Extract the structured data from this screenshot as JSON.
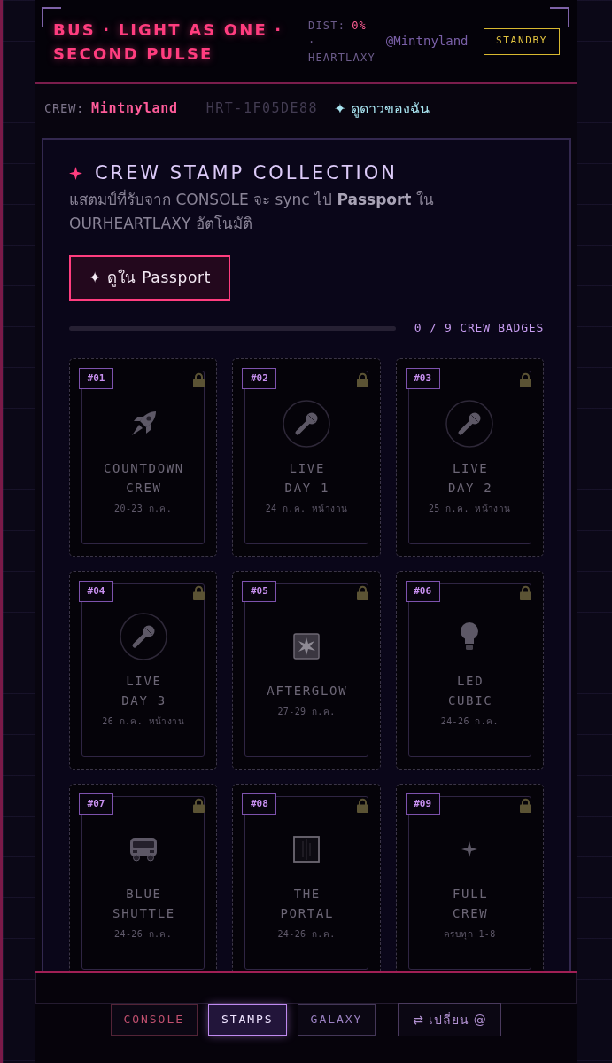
{
  "header": {
    "title": "BUS · LIGHT AS ONE · SECOND PULSE",
    "distance_label": "DIST:",
    "distance_value": "0%",
    "separator": "·",
    "network": "HEARTLAXY",
    "handle": "@Mintnyland",
    "status": "STANDBY"
  },
  "crew_bar": {
    "label": "CREW:",
    "name": "Mintnyland",
    "code": "HRT-1F05DE88",
    "link": "✦ ดูดาวของฉัน"
  },
  "collection": {
    "title": "CREW STAMP COLLECTION",
    "description": "แสตมป์ที่รับจาก CONSOLE จะ sync ไป **Passport** ใน OURHEARTLAXY อัตโนมัติ",
    "button": "✦ ดูใน Passport",
    "progress": {
      "level": 0,
      "label": "0 / 9 CREW BADGES"
    },
    "stamps": [
      {
        "number": "#01",
        "kind": "countdown",
        "title": "COUNTDOWN\nCREW",
        "date": "20-23 ก.ค.",
        "locked": true
      },
      {
        "number": "#02",
        "kind": "live",
        "title": "LIVE\nDAY 1",
        "date": "24 ก.ค. หน้างาน",
        "locked": true
      },
      {
        "number": "#03",
        "kind": "live",
        "title": "LIVE\nDAY 2",
        "date": "25 ก.ค. หน้างาน",
        "locked": true
      },
      {
        "number": "#04",
        "kind": "live",
        "title": "LIVE\nDAY 3",
        "date": "26 ก.ค. หน้างาน",
        "locked": true
      },
      {
        "number": "#05",
        "kind": "afterglow",
        "title": "AFTERGLOW",
        "date": "27-29 ก.ค.",
        "locked": true
      },
      {
        "number": "#06",
        "kind": "led",
        "title": "LED\nCUBIC",
        "date": "24-26 ก.ค.",
        "locked": true
      },
      {
        "number": "#07",
        "kind": "shuttle",
        "title": "BLUE\nSHUTTLE",
        "date": "24-26 ก.ค.",
        "locked": true
      },
      {
        "number": "#08",
        "kind": "portal",
        "title": "THE\nPORTAL",
        "date": "24-26 ก.ค.",
        "locked": true
      },
      {
        "number": "#09",
        "kind": "full",
        "title": "FULL\nCREW",
        "date": "ครบทุก 1-8",
        "locked": true
      }
    ]
  },
  "footer": {
    "tabs": [
      {
        "label": "CONSOLE",
        "selected": false,
        "color": "#c0506e"
      },
      {
        "label": "STAMPS",
        "selected": true,
        "color": "#c08af0"
      },
      {
        "label": "GALAXY",
        "selected": false,
        "color": "#9a80c0"
      }
    ],
    "switch_button": "⇄ เปลี่ยน @"
  }
}
